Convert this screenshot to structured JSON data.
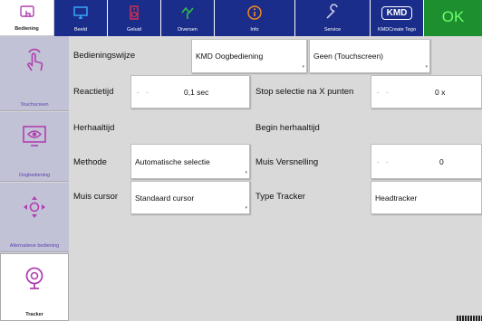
{
  "tabs": {
    "bediening": "Bediening",
    "beeld": "Beeld",
    "geluid": "Geluid",
    "diversen": "Diversen",
    "info": "Info",
    "service": "Service",
    "kmd_logo": "KMD",
    "kmd": "KMDCreate Tego",
    "ok": "OK"
  },
  "sidebar": {
    "items": [
      {
        "label": "Touchscreen",
        "icon": "touch-hand-icon"
      },
      {
        "label": "Oogbediening",
        "icon": "eye-screen-icon"
      },
      {
        "label": "Alternatieve bediening",
        "icon": "arrows-icon"
      },
      {
        "label": "Tracker",
        "icon": "webcam-icon"
      }
    ]
  },
  "form": {
    "bedieningswijze_label": "Bedieningswijze",
    "bedieningswijze_value": "KMD Oogbediening",
    "touchscreen_value": "Geen (Touchscreen)",
    "reactietijd_label": "Reactietijd",
    "reactietijd_minus": "-",
    "reactietijd_plus": "-",
    "reactietijd_value": "0,1 sec",
    "stop_selectie_label": "Stop selectie na X punten",
    "stop_selectie_minus": "-",
    "stop_selectie_plus": "-",
    "stop_selectie_value": "0 x",
    "herhaaltijd_label": "Herhaaltijd",
    "begin_herhaaltijd_label": "Begin herhaaltijd",
    "methode_label": "Methode",
    "methode_value": "Automatische selectie",
    "muis_versnelling_label": "Muis Versnelling",
    "muis_versnelling_minus": "-",
    "muis_versnelling_plus": "-",
    "muis_versnelling_value": "0",
    "muis_cursor_label": "Muis cursor",
    "muis_cursor_value": "Standaard cursor",
    "type_tracker_label": "Type Tracker",
    "type_tracker_value": "Headtracker"
  },
  "colors": {
    "tab_blue": "#1a2d8a",
    "ok_green": "#1e8f2e",
    "sidebar_bg": "#c2c2d6",
    "accent_purple": "#5a3fb0",
    "main_bg": "#d9d9d9"
  }
}
